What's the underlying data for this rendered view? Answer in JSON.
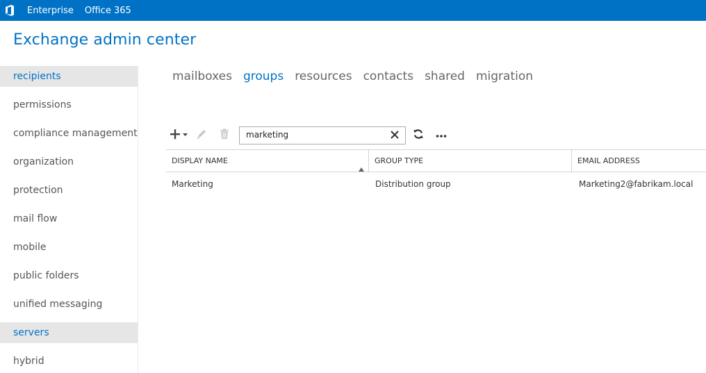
{
  "topbar": {
    "logo_icon": "office-logo-icon",
    "links": [
      "Enterprise",
      "Office 365"
    ],
    "color": "#0072c6"
  },
  "app": {
    "title": "Exchange admin center"
  },
  "sidebar": {
    "items": [
      {
        "label": "recipients",
        "state": "selected"
      },
      {
        "label": "permissions"
      },
      {
        "label": "compliance management"
      },
      {
        "label": "organization"
      },
      {
        "label": "protection"
      },
      {
        "label": "mail flow"
      },
      {
        "label": "mobile"
      },
      {
        "label": "public folders"
      },
      {
        "label": "unified messaging"
      },
      {
        "label": "servers",
        "state": "hover"
      },
      {
        "label": "hybrid"
      }
    ]
  },
  "tabs": [
    {
      "label": "mailboxes"
    },
    {
      "label": "groups",
      "active": true
    },
    {
      "label": "resources"
    },
    {
      "label": "contacts"
    },
    {
      "label": "shared"
    },
    {
      "label": "migration"
    }
  ],
  "toolbar": {
    "icons": [
      "add-icon",
      "edit-icon",
      "delete-icon",
      "refresh-icon",
      "more-icon"
    ],
    "search": {
      "value": "marketing",
      "clear_icon": "close-icon"
    }
  },
  "grid": {
    "columns": [
      "DISPLAY NAME",
      "GROUP TYPE",
      "EMAIL ADDRESS"
    ],
    "sort": {
      "column": "DISPLAY NAME",
      "direction": "ascending"
    },
    "rows": [
      {
        "display_name": "Marketing",
        "group_type": "Distribution group",
        "email": "Marketing2@fabrikam.local"
      }
    ]
  }
}
